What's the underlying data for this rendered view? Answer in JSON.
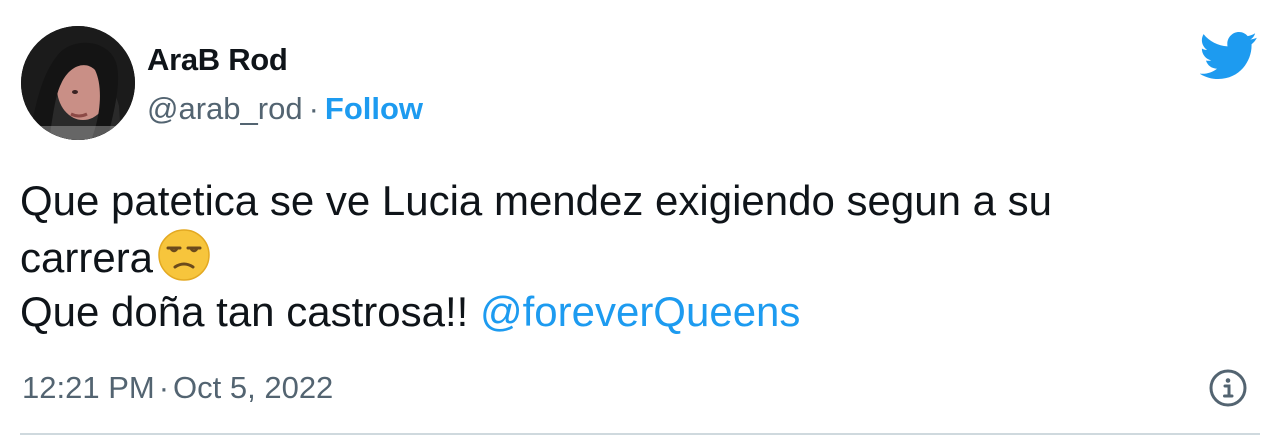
{
  "tweet": {
    "author": {
      "display_name": "AraB Rod",
      "handle": "@arab_rod",
      "separator": "·",
      "follow_label": "Follow"
    },
    "brand_icon": "twitter-bird-icon",
    "text": {
      "line1": "Que patetica se ve Lucia mendez exigiendo segun a su",
      "line2": "carrera",
      "emoji": "unamused-face-emoji",
      "line3": "Que doña tan castrosa!!",
      "mention": "@foreverQueens"
    },
    "meta": {
      "time": "12:21 PM",
      "separator": "·",
      "date": "Oct 5, 2022",
      "info_icon": "info-icon"
    },
    "colors": {
      "link": "#1d9bf0",
      "text": "#0f1419",
      "secondary": "#536471",
      "emoji": "#f7c53c"
    }
  }
}
